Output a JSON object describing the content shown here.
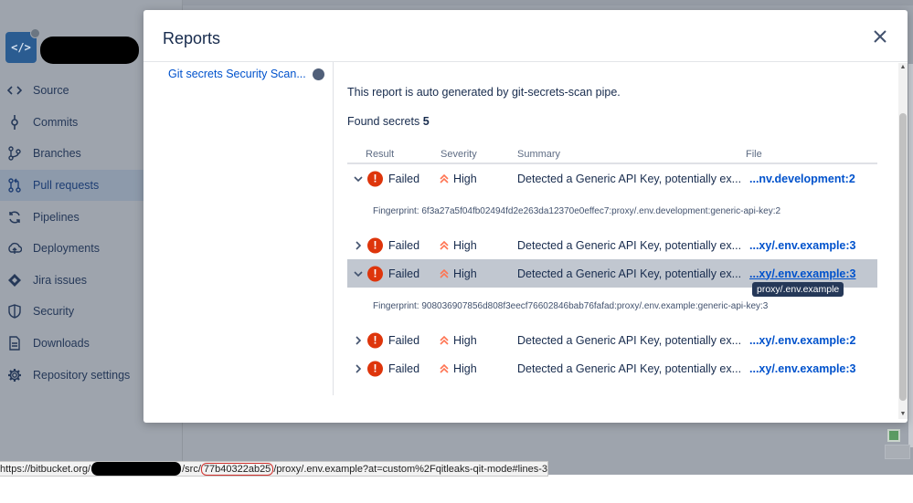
{
  "sidebar": {
    "items": [
      {
        "label": "Source",
        "icon": "code-icon"
      },
      {
        "label": "Commits",
        "icon": "commit-icon"
      },
      {
        "label": "Branches",
        "icon": "branch-icon"
      },
      {
        "label": "Pull requests",
        "icon": "pull-request-icon",
        "active": true
      },
      {
        "label": "Pipelines",
        "icon": "pipelines-icon"
      },
      {
        "label": "Deployments",
        "icon": "deployments-icon"
      },
      {
        "label": "Jira issues",
        "icon": "jira-icon"
      },
      {
        "label": "Security",
        "icon": "shield-icon"
      },
      {
        "label": "Downloads",
        "icon": "downloads-icon"
      },
      {
        "label": "Repository settings",
        "icon": "gear-icon"
      }
    ]
  },
  "modal": {
    "title": "Reports",
    "report_item": "Git secrets Security Scan...",
    "intro": "This report is auto generated by git-secrets-scan pipe.",
    "found_label": "Found secrets",
    "found_count": "5",
    "headers": {
      "result": "Result",
      "severity": "Severity",
      "summary": "Summary",
      "file": "File"
    },
    "rows": [
      {
        "result": "Failed",
        "severity": "High",
        "summary": "Detected a Generic API Key, potentially ex...",
        "file": "...nv.development:2",
        "expanded": true,
        "fingerprint": "Fingerprint: 6f3a27a5f04fb02494fd2e263da12370e0effec7:proxy/.env.development:generic-api-key:2"
      },
      {
        "result": "Failed",
        "severity": "High",
        "summary": "Detected a Generic API Key, potentially ex...",
        "file": "...xy/.env.example:3",
        "expanded": false
      },
      {
        "result": "Failed",
        "severity": "High",
        "summary": "Detected a Generic API Key, potentially ex...",
        "file": "...xy/.env.example:3",
        "expanded": true,
        "highlighted": true,
        "fingerprint": "Fingerprint: 908036907856d808f3eecf76602846bab76fafad:proxy/.env.example:generic-api-key:3"
      },
      {
        "result": "Failed",
        "severity": "High",
        "summary": "Detected a Generic API Key, potentially ex...",
        "file": "...xy/.env.example:2",
        "expanded": false
      },
      {
        "result": "Failed",
        "severity": "High",
        "summary": "Detected a Generic API Key, potentially ex...",
        "file": "...xy/.env.example:3",
        "expanded": false
      }
    ],
    "tooltip": "proxy/.env.example"
  },
  "statusbar": {
    "prefix": "https://bitbucket.org/",
    "mid": "/src/",
    "hash": "77b40322ab25",
    "suffix": "/proxy/.env.example?at=custom%2Fqitleaks-qit-mode#lines-3"
  },
  "colors": {
    "error": "#de350b",
    "link": "#0052cc",
    "severity_high": "#ff7452",
    "highlight_row": "#c1c7d0"
  }
}
